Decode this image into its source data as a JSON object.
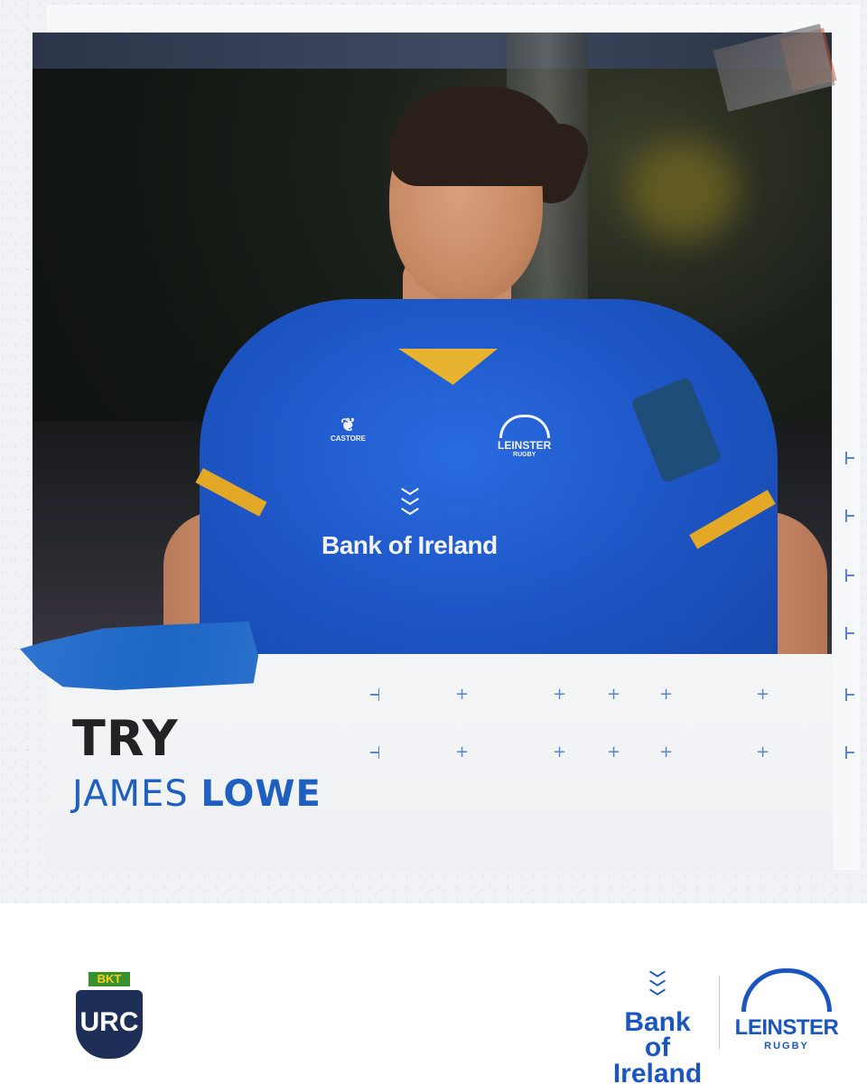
{
  "headline": "TRY",
  "player": {
    "first_name": "JAMES",
    "last_name": "LOWE"
  },
  "jersey": {
    "sponsor": "Bank of Ireland",
    "kit_brand": "CASTORE",
    "crest_name": "LEINSTER",
    "crest_sub": "RUGBY"
  },
  "logos": {
    "competition_sponsor": "BKT",
    "competition": "URC",
    "partner_line1": "Bank of",
    "partner_line2": "Ireland",
    "club": "LEINSTER",
    "club_sub": "RUGBY"
  },
  "colors": {
    "accent_blue": "#1f5fbf",
    "tape_blue": "#1d66c4",
    "headline": "#222325",
    "jersey_blue": "#1e57c8",
    "gold": "#e3a826"
  },
  "icons": [
    "kit-brand-icon",
    "sponsor-chevrons-icon",
    "crest-icon"
  ]
}
